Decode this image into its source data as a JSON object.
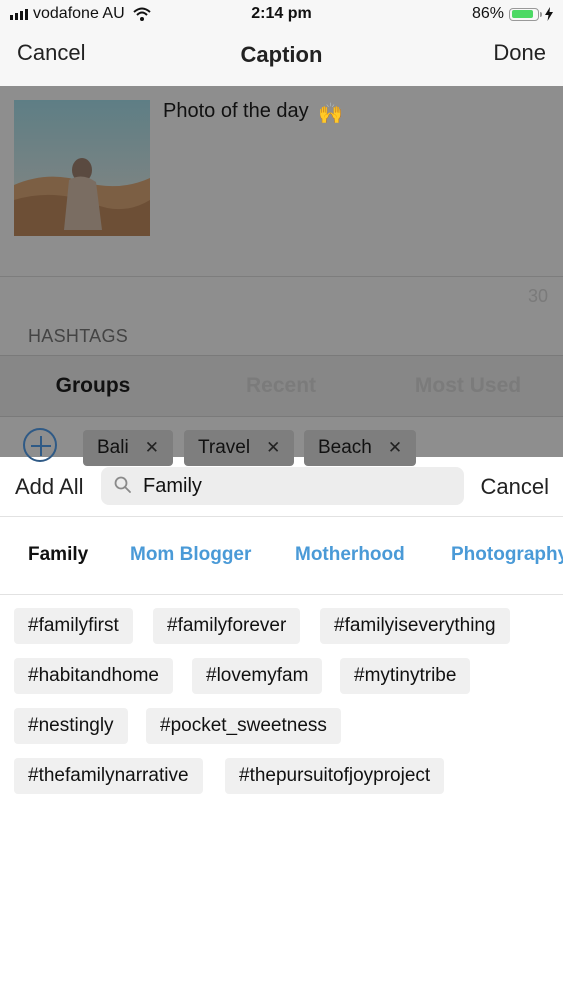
{
  "status_bar": {
    "carrier": "vodafone AU",
    "time": "2:14 pm",
    "battery": "86%",
    "battery_level": 0.86,
    "icons": [
      "signal-icon",
      "wifi-icon",
      "battery-icon",
      "charging-icon"
    ]
  },
  "nav": {
    "cancel": "Cancel",
    "title": "Caption",
    "done": "Done"
  },
  "post": {
    "caption": "Photo of the day",
    "emoji": "🙌",
    "remaining_count": "30"
  },
  "hashtags_section": {
    "label": "HASHTAGS",
    "tabs": [
      "Groups",
      "Recent",
      "Most Used"
    ],
    "selected_tab": "Groups",
    "groups": [
      "Bali",
      "Travel",
      "Beach"
    ]
  },
  "search": {
    "add_all": "Add All",
    "query": "Family",
    "cancel": "Cancel"
  },
  "categories": [
    "Family",
    "Mom Blogger",
    "Motherhood",
    "Photography"
  ],
  "hashtags": [
    "#familyfirst",
    "#familyforever",
    "#familyiseverything",
    "#habitandhome",
    "#lovemyfam",
    "#mytinytribe",
    "#nestingly",
    "#pocket_sweetness",
    "#thefamilynarrative",
    "#thepursuitofjoyproject"
  ],
  "colors": {
    "accent": "#4a9ad7",
    "overlay": "#8e8e8e",
    "chip_bg": "#f0f0f0",
    "battery_green": "#4cd964"
  }
}
